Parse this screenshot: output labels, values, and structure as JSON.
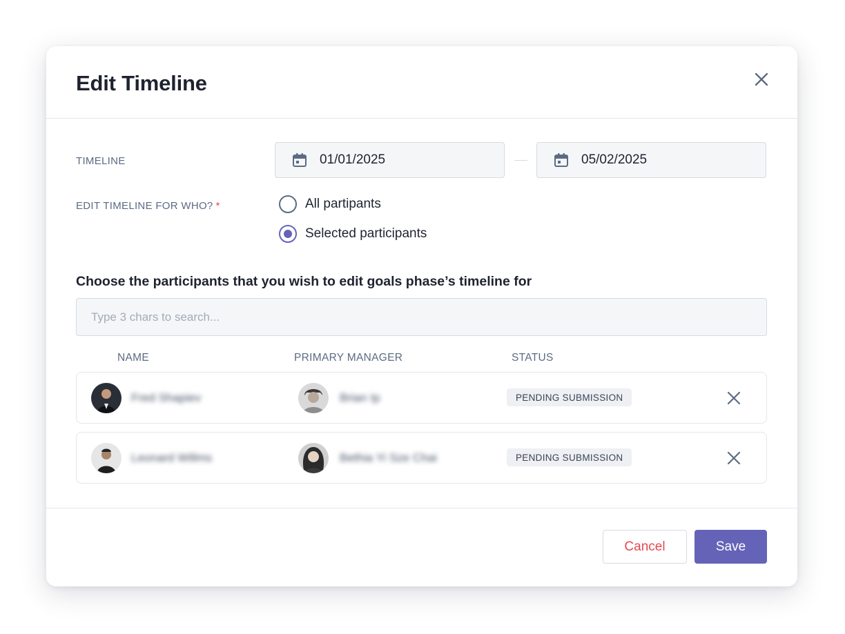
{
  "dialog": {
    "title": "Edit Timeline",
    "close_icon": "close-icon"
  },
  "timeline": {
    "label": "TIMELINE",
    "start_date": "01/01/2025",
    "end_date": "05/02/2025",
    "calendar_icon": "calendar-icon"
  },
  "who": {
    "label": "EDIT TIMELINE FOR WHO?",
    "required_mark": "*",
    "options": [
      {
        "label": "All partipants",
        "selected": false
      },
      {
        "label": "Selected participants",
        "selected": true
      }
    ]
  },
  "participants": {
    "heading": "Choose the participants that you wish to edit goals phase’s timeline for",
    "search_placeholder": "Type 3 chars to search...",
    "columns": {
      "name": "NAME",
      "manager": "PRIMARY MANAGER",
      "status": "STATUS"
    },
    "rows": [
      {
        "name": "Fred Shapiev",
        "manager": "Brian Ip",
        "status": "PENDING SUBMISSION"
      },
      {
        "name": "Leonard Willms",
        "manager": "Bethia Yi Sze Chai",
        "status": "PENDING SUBMISSION"
      }
    ]
  },
  "footer": {
    "cancel_label": "Cancel",
    "save_label": "Save"
  },
  "colors": {
    "accent": "#6563b8",
    "danger": "#e5484d",
    "muted_text": "#5b6b82",
    "field_bg": "#f5f6f8"
  }
}
